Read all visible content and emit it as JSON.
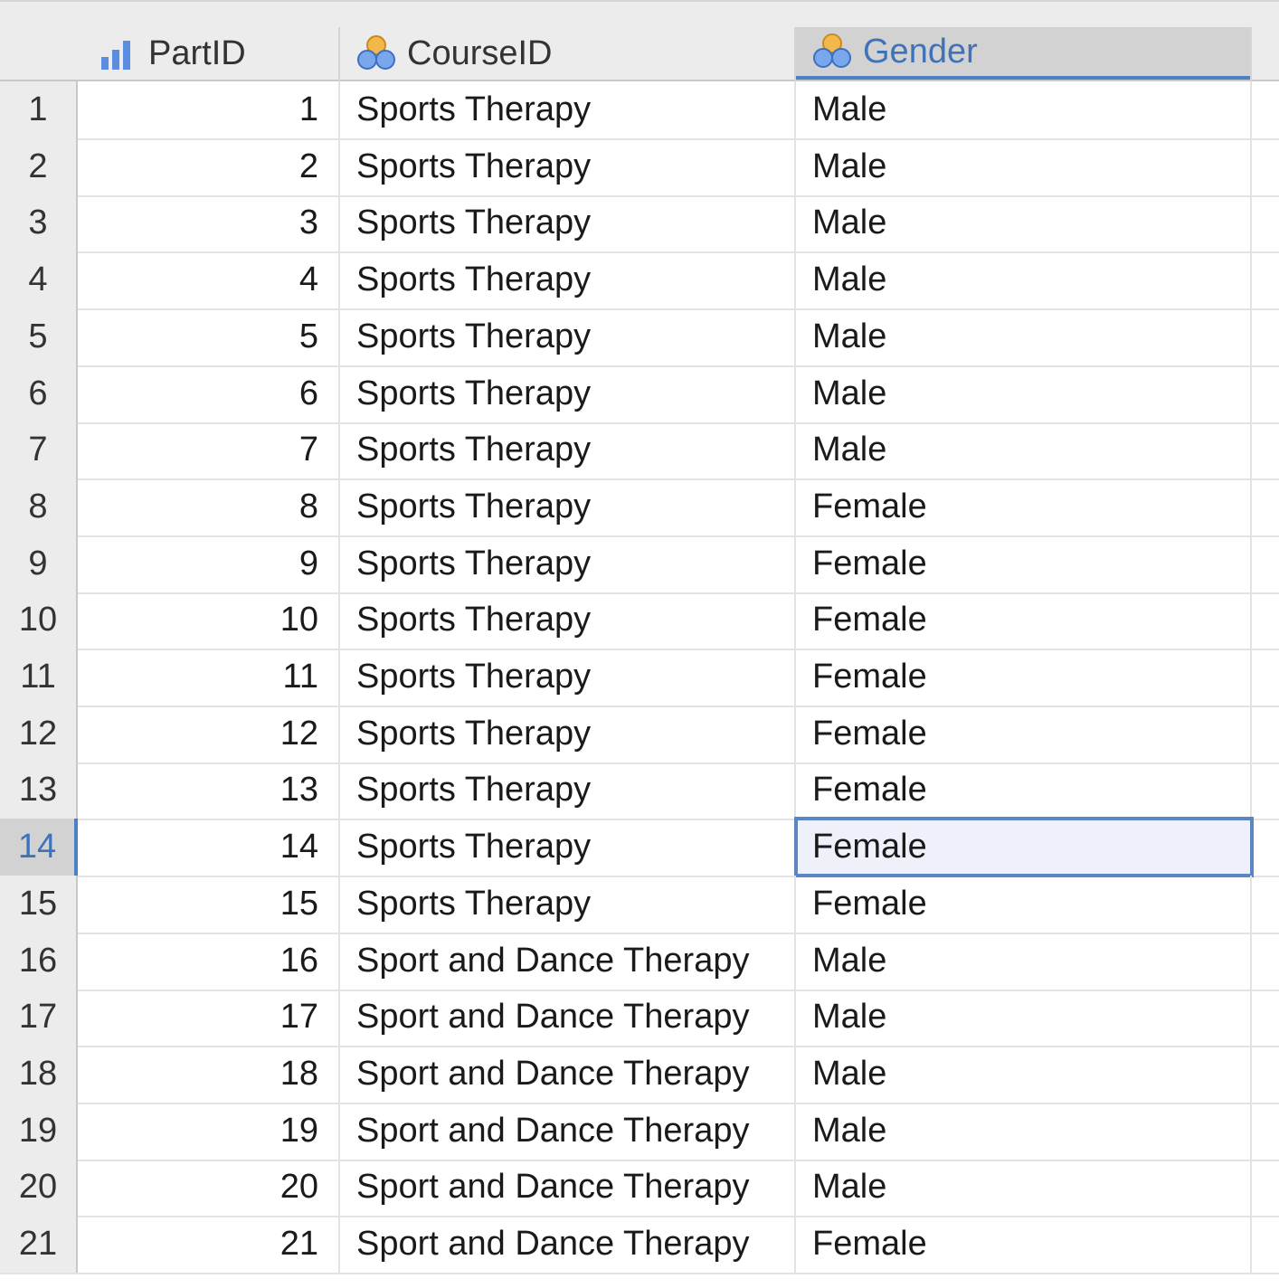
{
  "columns": [
    {
      "name": "PartID",
      "icon": "scale-bar-icon"
    },
    {
      "name": "CourseID",
      "icon": "nominal-circles-icon"
    },
    {
      "name": "Gender",
      "icon": "nominal-circles-icon"
    }
  ],
  "selected_column": "Gender",
  "selected_row": "14",
  "rows": [
    {
      "n": "1",
      "part": "1",
      "course": "Sports Therapy",
      "gender": "Male"
    },
    {
      "n": "2",
      "part": "2",
      "course": "Sports Therapy",
      "gender": "Male"
    },
    {
      "n": "3",
      "part": "3",
      "course": "Sports Therapy",
      "gender": "Male"
    },
    {
      "n": "4",
      "part": "4",
      "course": "Sports Therapy",
      "gender": "Male"
    },
    {
      "n": "5",
      "part": "5",
      "course": "Sports Therapy",
      "gender": "Male"
    },
    {
      "n": "6",
      "part": "6",
      "course": "Sports Therapy",
      "gender": "Male"
    },
    {
      "n": "7",
      "part": "7",
      "course": "Sports Therapy",
      "gender": "Male"
    },
    {
      "n": "8",
      "part": "8",
      "course": "Sports Therapy",
      "gender": "Female"
    },
    {
      "n": "9",
      "part": "9",
      "course": "Sports Therapy",
      "gender": "Female"
    },
    {
      "n": "10",
      "part": "10",
      "course": "Sports Therapy",
      "gender": "Female"
    },
    {
      "n": "11",
      "part": "11",
      "course": "Sports Therapy",
      "gender": "Female"
    },
    {
      "n": "12",
      "part": "12",
      "course": "Sports Therapy",
      "gender": "Female"
    },
    {
      "n": "13",
      "part": "13",
      "course": "Sports Therapy",
      "gender": "Female"
    },
    {
      "n": "14",
      "part": "14",
      "course": "Sports Therapy",
      "gender": "Female"
    },
    {
      "n": "15",
      "part": "15",
      "course": "Sports Therapy",
      "gender": "Female"
    },
    {
      "n": "16",
      "part": "16",
      "course": "Sport and Dance Therapy",
      "gender": "Male"
    },
    {
      "n": "17",
      "part": "17",
      "course": "Sport and Dance Therapy",
      "gender": "Male"
    },
    {
      "n": "18",
      "part": "18",
      "course": "Sport and Dance Therapy",
      "gender": "Male"
    },
    {
      "n": "19",
      "part": "19",
      "course": "Sport and Dance Therapy",
      "gender": "Male"
    },
    {
      "n": "20",
      "part": "20",
      "course": "Sport and Dance Therapy",
      "gender": "Male"
    },
    {
      "n": "21",
      "part": "21",
      "course": "Sport and Dance Therapy",
      "gender": "Female"
    }
  ],
  "colors": {
    "accent": "#4d7fc4",
    "icon_blue": "#5b8ee0",
    "icon_orange": "#f2b84b"
  }
}
